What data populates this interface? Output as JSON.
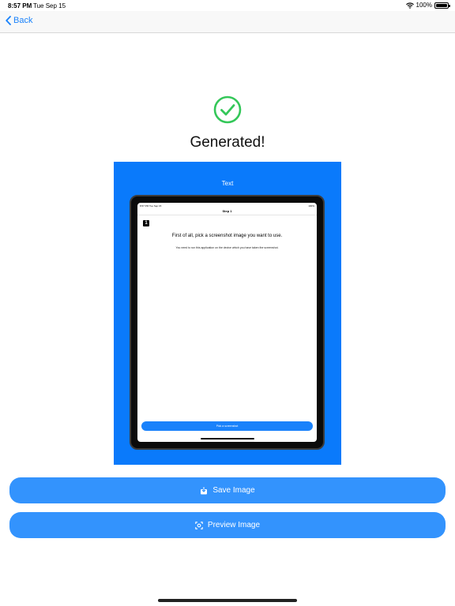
{
  "status_bar": {
    "time": "8:57 PM",
    "date": "Tue Sep 15",
    "battery": "100%"
  },
  "nav": {
    "back_label": "Back"
  },
  "main": {
    "title": "Generated!"
  },
  "preview": {
    "caption": "Text",
    "device": {
      "status_time": "8:57 PM  Tue Sep 15",
      "status_battery": "100%",
      "nav_title": "Step 1",
      "step_number": "1",
      "heading": "First of all, pick a screenshot image you want to use.",
      "subtext": "You need to run this application on the device which you have taken the screenshot.",
      "button_label": "Pick a screenshot"
    }
  },
  "actions": {
    "save_label": "Save Image",
    "preview_label": "Preview Image"
  },
  "colors": {
    "accent": "#1a82fb",
    "button": "#3393fd",
    "preview_bg": "#0a7afb",
    "success": "#34c759"
  }
}
